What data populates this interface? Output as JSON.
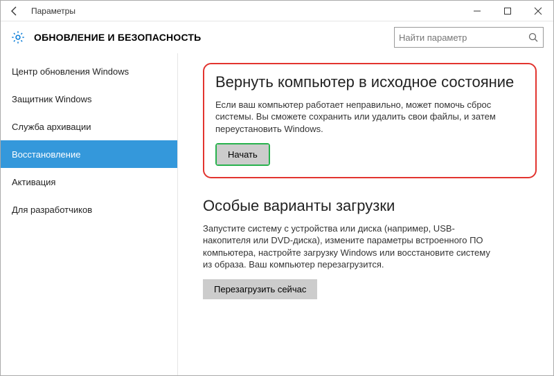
{
  "window": {
    "title": "Параметры"
  },
  "header": {
    "section": "ОБНОВЛЕНИЕ И БЕЗОПАСНОСТЬ",
    "search_placeholder": "Найти параметр"
  },
  "sidebar": {
    "items": [
      {
        "label": "Центр обновления Windows"
      },
      {
        "label": "Защитник Windows"
      },
      {
        "label": "Служба архивации"
      },
      {
        "label": "Восстановление"
      },
      {
        "label": "Активация"
      },
      {
        "label": "Для разработчиков"
      }
    ],
    "active_index": 3
  },
  "content": {
    "reset": {
      "title": "Вернуть компьютер в исходное состояние",
      "desc": "Если ваш компьютер работает неправильно, может помочь сброс системы. Вы сможете сохранить или удалить свои файлы, и затем переустановить Windows.",
      "button": "Начать"
    },
    "advanced": {
      "title": "Особые варианты загрузки",
      "desc": "Запустите систему с устройства или диска (например, USB-накопителя или DVD-диска), измените параметры встроенного ПО компьютера, настройте загрузку Windows или восстановите систему из образа. Ваш компьютер перезагрузится.",
      "button": "Перезагрузить сейчас"
    }
  }
}
